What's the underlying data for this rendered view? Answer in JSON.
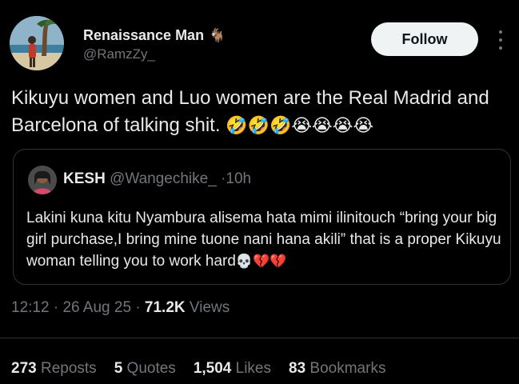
{
  "author": {
    "display_name": "Renaissance Man",
    "badge_emoji": "🐐",
    "handle": "@RamzZy_",
    "avatar_icon": "profile-photo-icon"
  },
  "actions": {
    "follow_label": "Follow",
    "more_icon": "more-vertical-icon"
  },
  "tweet": {
    "text": "Kikuyu women and Luo women are the Real Madrid and Barcelona of talking shit.",
    "emojis": "🤣🤣🤣😭😭😭😭"
  },
  "quoted": {
    "display_name": "KESH",
    "handle": "@Wangechike_",
    "separator": "·",
    "time": "10h",
    "text": "Lakini kuna kitu Nyambura alisema hata mimi ilinitouch “bring your big girl purchase,I bring mine tuone nani hana akili” that is a proper Kikuyu woman telling you to work hard",
    "emojis": "💀💔💔"
  },
  "meta": {
    "time": "12:12",
    "sep1": "·",
    "date": "26 Aug 25",
    "sep2": "·",
    "views_count": "71.2K",
    "views_label": "Views"
  },
  "stats": [
    {
      "count": "273",
      "label": "Reposts"
    },
    {
      "count": "5",
      "label": "Quotes"
    },
    {
      "count": "1,504",
      "label": "Likes"
    },
    {
      "count": "83",
      "label": "Bookmarks"
    }
  ],
  "colors": {
    "background": "#000000",
    "primary_text": "#e7e9ea",
    "secondary_text": "#71767b",
    "border": "#2f3336",
    "follow_bg": "#eff3f4"
  }
}
